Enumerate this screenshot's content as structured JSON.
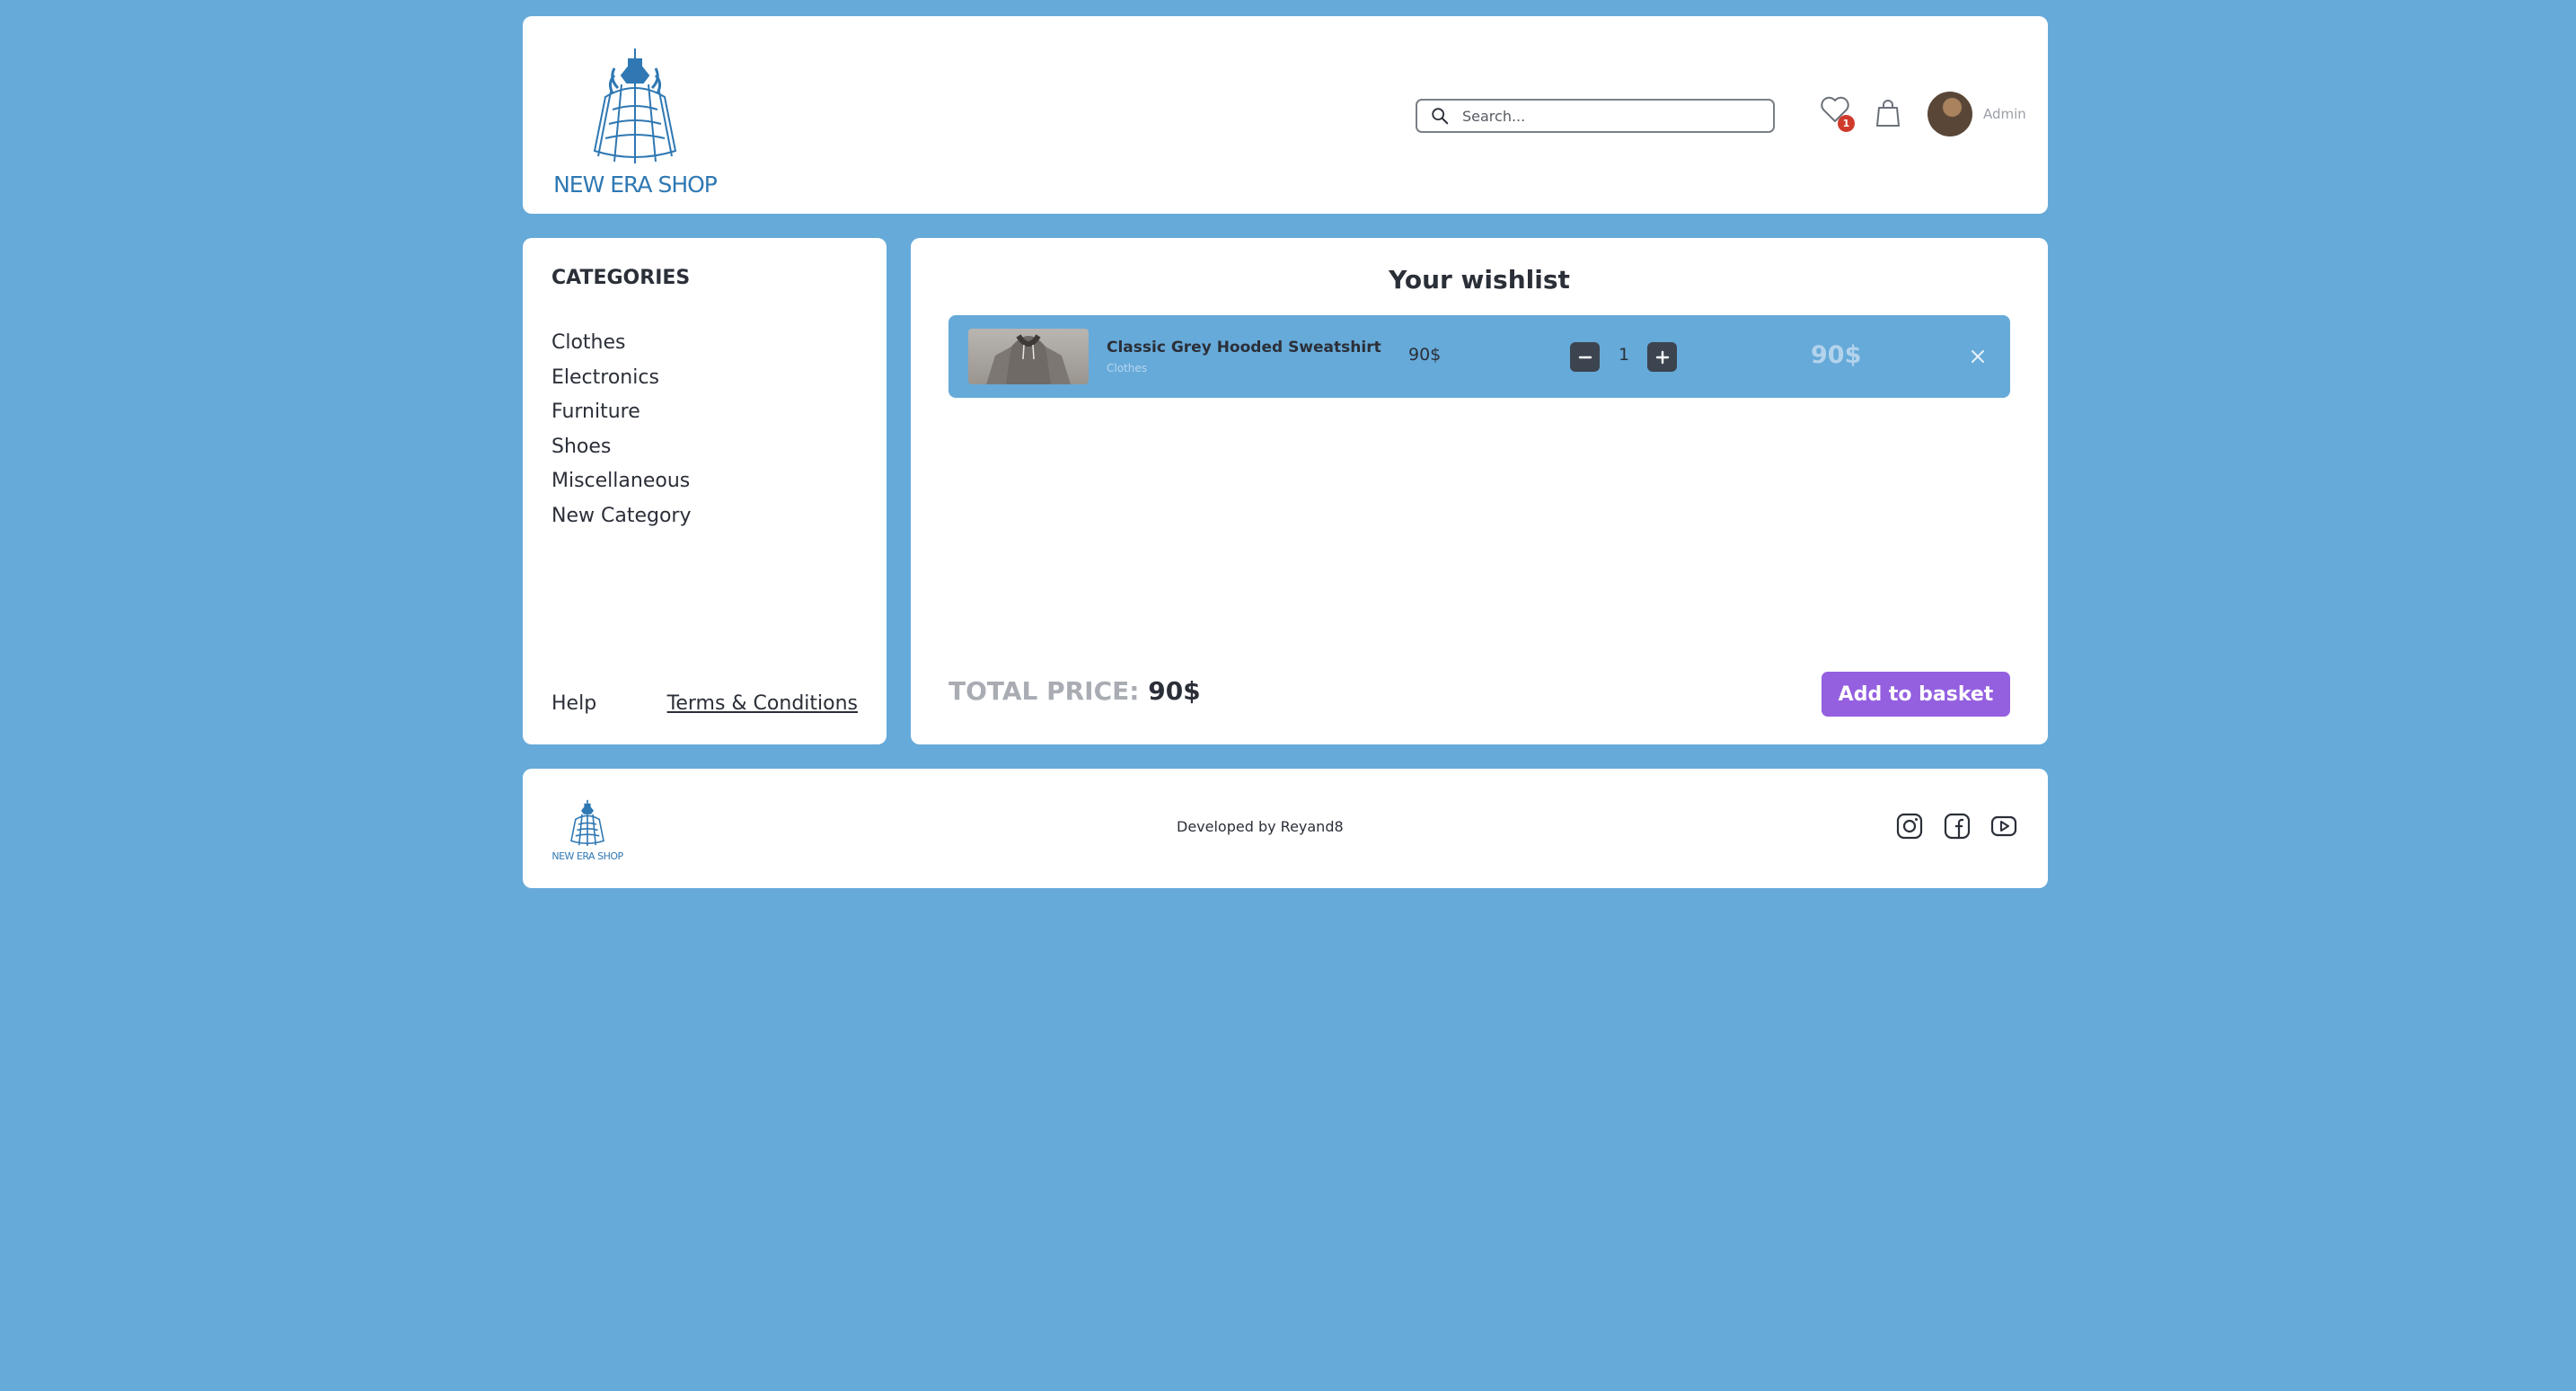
{
  "header": {
    "logo_text": "NEW ERA SHOP",
    "search_placeholder": "Search...",
    "search_value": "",
    "wishlist_count": "1",
    "user_name": "Admin"
  },
  "sidebar": {
    "title": "CATEGORIES",
    "categories": [
      "Clothes",
      "Electronics",
      "Furniture",
      "Shoes",
      "Miscellaneous",
      "New Category"
    ],
    "help_label": "Help",
    "terms_label": "Terms & Conditions"
  },
  "wishlist": {
    "title": "Your wishlist",
    "items": [
      {
        "name": "Classic Grey Hooded Sweatshirt",
        "category": "Clothes",
        "price": "90$",
        "quantity": "1",
        "total": "90$"
      }
    ],
    "total_label": "TOTAL PRICE:",
    "total_value": "90$",
    "add_button": "Add to basket"
  },
  "footer": {
    "logo_text": "NEW ERA SHOP",
    "developer_text": "Developed by Reyand8",
    "social": [
      "instagram-icon",
      "facebook-icon",
      "youtube-icon"
    ]
  },
  "colors": {
    "background": "#66aad9",
    "accent": "#9460e0",
    "badge": "#d03a2b",
    "text": "#2b2f38"
  }
}
